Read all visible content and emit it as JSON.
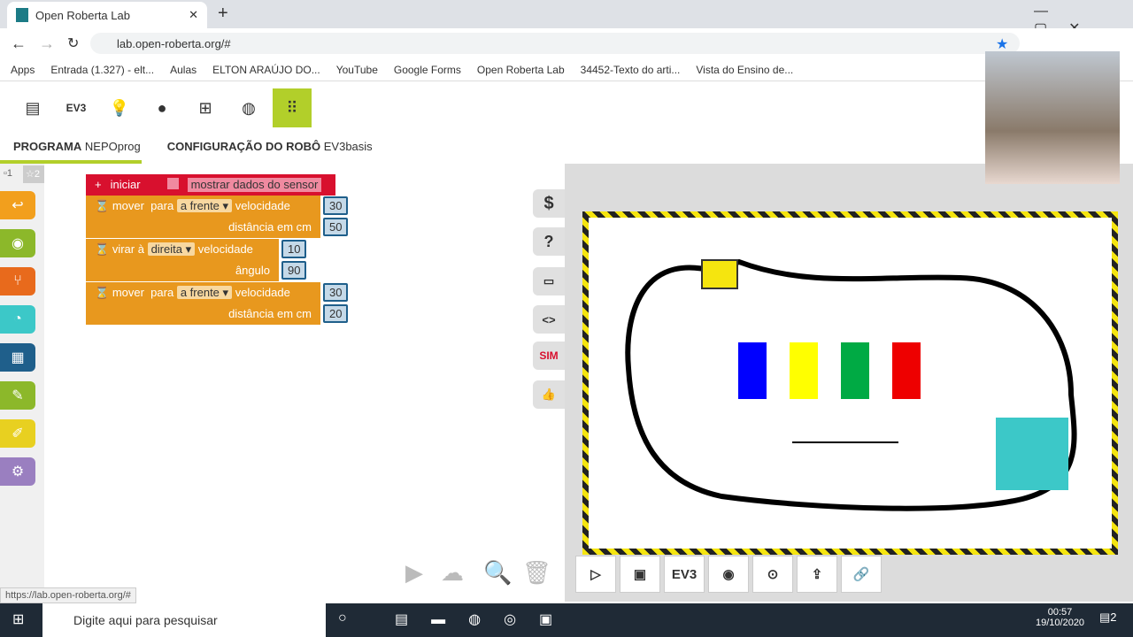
{
  "browser": {
    "tab_title": "Open Roberta Lab",
    "url": "lab.open-roberta.org/#",
    "status_url": "https://lab.open-roberta.org/#",
    "bookmarks": [
      "Apps",
      "Entrada (1.327) - elt...",
      "Aulas",
      "ELTON ARAÚJO DO...",
      "YouTube",
      "Google Forms",
      "Open Roberta Lab",
      "34452-Texto do arti...",
      "Vista do Ensino de..."
    ]
  },
  "toolbar": {
    "items": [
      "menu-icon",
      "EV3",
      "lightbulb-icon",
      "user-icon",
      "grid-icon",
      "globe-icon",
      "apps-icon"
    ]
  },
  "prog_tabs": {
    "program_label": "PROGRAMA",
    "program_name": "NEPOprog",
    "config_label": "CONFIGURAÇÃO DO ROBÔ",
    "config_name": "EV3basis"
  },
  "levels": [
    "1",
    "2"
  ],
  "blocks": {
    "start": {
      "label": "iniciar",
      "sensor": "mostrar dados do sensor"
    },
    "move1": {
      "verb": "mover",
      "para": "para",
      "dir": "a frente",
      "speed_label": "velocidade",
      "speed": "30",
      "dist_label": "distância em cm",
      "dist": "50"
    },
    "turn": {
      "verb": "virar à",
      "dir": "direita",
      "speed_label": "velocidade",
      "speed": "10",
      "angle_label": "ângulo",
      "angle": "90"
    },
    "move2": {
      "verb": "mover",
      "para": "para",
      "dir": "a frente",
      "speed_label": "velocidade",
      "speed": "30",
      "dist_label": "distância em cm",
      "dist": "20"
    }
  },
  "side_tools": {
    "sim": "SIM"
  },
  "sim_bar": {
    "ev3": "EV3"
  },
  "sim_colors": [
    "#0000ff",
    "#ffff00",
    "#00aa44",
    "#ee0000",
    "#3cc8c8"
  ],
  "taskbar": {
    "search_placeholder": "Digite aqui para pesquisar",
    "time": "00:57",
    "date": "19/10/2020",
    "notifications": "2"
  }
}
